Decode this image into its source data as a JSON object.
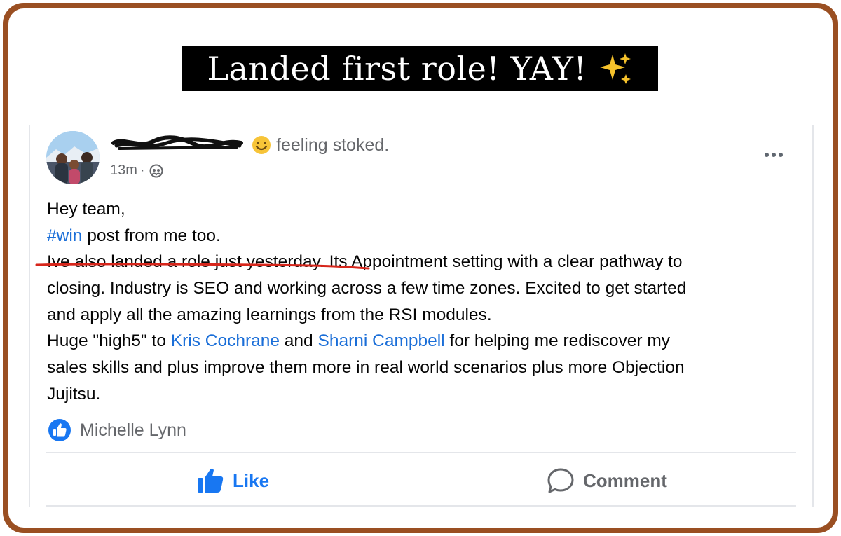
{
  "banner": {
    "title": "Landed first role! YAY!",
    "icon": "sparkles-icon"
  },
  "post": {
    "feeling": "feeling stoked.",
    "time": "13m",
    "separator": "·",
    "audience_icon": "friends-icon",
    "body": {
      "line1": "Hey team,",
      "hashtag": "#win",
      "line2_rest": " post from me too.",
      "line3_highlight": "Ive also landed a role just yesterday.",
      "line3_rest": " Its Appointment setting with a clear pathway to",
      "line4": "closing. Industry is SEO and working across a few time zones. Excited to get started",
      "line5": "and apply all the amazing learnings from the RSI modules.",
      "line6_pre": "Huge \"high5\" to ",
      "mention1": "Kris Cochrane",
      "line6_mid": " and ",
      "mention2": "Sharni Campbell",
      "line6_post": " for helping me rediscover my",
      "line7": "sales skills and plus improve them more in real world scenarios plus more Objection",
      "line8": "Jujitsu."
    },
    "reaction_name": "Michelle Lynn"
  },
  "actions": {
    "like_label": "Like",
    "comment_label": "Comment"
  },
  "colors": {
    "frame": "#9a4f22",
    "link": "#1a6ed8",
    "like_blue": "#1877f2",
    "muted": "#65676b",
    "annotation": "#d7261b"
  }
}
